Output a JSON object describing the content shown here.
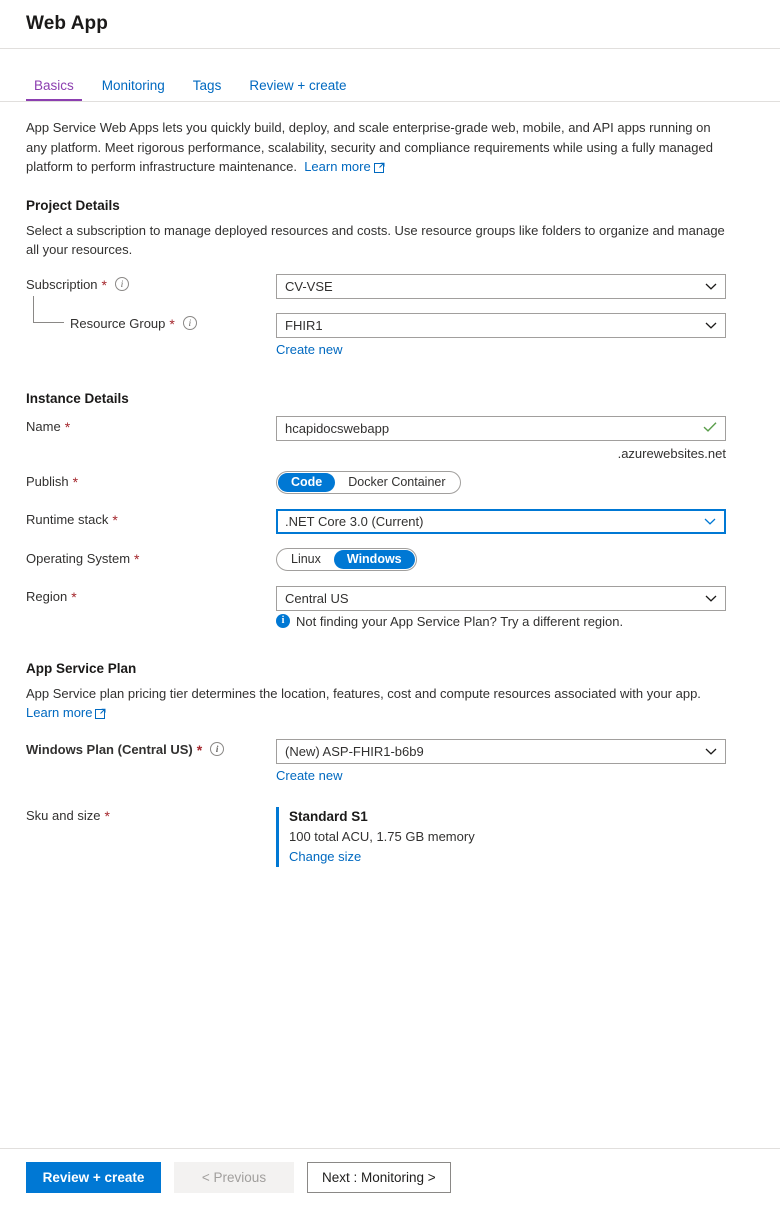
{
  "header": {
    "title": "Web App"
  },
  "tabs": [
    {
      "label": "Basics",
      "active": true
    },
    {
      "label": "Monitoring",
      "active": false
    },
    {
      "label": "Tags",
      "active": false
    },
    {
      "label": "Review + create",
      "active": false
    }
  ],
  "intro": {
    "text": "App Service Web Apps lets you quickly build, deploy, and scale enterprise-grade web, mobile, and API apps running on any platform. Meet rigorous performance, scalability, security and compliance requirements while using a fully managed platform to perform infrastructure maintenance.",
    "learn_more": "Learn more"
  },
  "project_details": {
    "title": "Project Details",
    "description": "Select a subscription to manage deployed resources and costs. Use resource groups like folders to organize and manage all your resources.",
    "subscription": {
      "label": "Subscription",
      "value": "CV-VSE",
      "info_icon": "info-circle-icon"
    },
    "resource_group": {
      "label": "Resource Group",
      "value": "FHIR1",
      "create_new": "Create new",
      "info_icon": "info-circle-icon"
    }
  },
  "instance_details": {
    "title": "Instance Details",
    "name": {
      "label": "Name",
      "value": "hcapidocswebapp",
      "suffix": ".azurewebsites.net",
      "validation_icon": "checkmark-icon",
      "validation_color": "#5a9e4b"
    },
    "publish": {
      "label": "Publish",
      "options": [
        "Code",
        "Docker Container"
      ],
      "selected": "Code"
    },
    "runtime_stack": {
      "label": "Runtime stack",
      "value": ".NET Core 3.0 (Current)",
      "focused": true
    },
    "operating_system": {
      "label": "Operating System",
      "options": [
        "Linux",
        "Windows"
      ],
      "selected": "Windows"
    },
    "region": {
      "label": "Region",
      "value": "Central US",
      "note": "Not finding your App Service Plan? Try a different region.",
      "note_icon": "info-filled-icon"
    }
  },
  "app_service_plan": {
    "title": "App Service Plan",
    "description": "App Service plan pricing tier determines the location, features, cost and compute resources associated with your app.",
    "learn_more": "Learn more",
    "windows_plan": {
      "label": "Windows Plan (Central US)",
      "value": "(New) ASP-FHIR1-b6b9",
      "create_new": "Create new",
      "info_icon": "info-circle-icon"
    },
    "sku_and_size": {
      "label": "Sku and size",
      "tier": "Standard S1",
      "details": "100 total ACU, 1.75 GB memory",
      "change_link": "Change size"
    }
  },
  "footer": {
    "review_create": "Review + create",
    "previous": "< Previous",
    "next": "Next : Monitoring >"
  },
  "colors": {
    "accent": "#0078d4",
    "tab_active": "#8c3fb0",
    "link": "#0069c0",
    "required": "#a4262c",
    "validation_ok": "#5a9e4b"
  }
}
